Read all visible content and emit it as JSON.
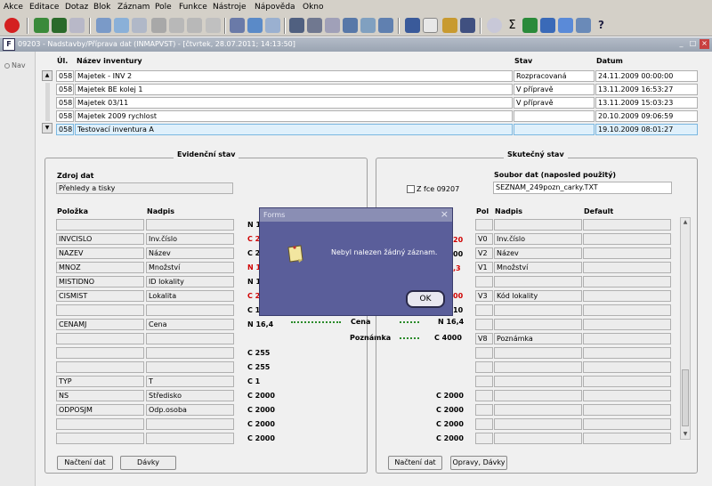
{
  "menu": [
    "Akce",
    "Editace",
    "Dotaz",
    "Blok",
    "Záznam",
    "Pole",
    "Funkce",
    "Nástroje",
    "Nápověda",
    "Okno"
  ],
  "window": {
    "title": "09203 - Nadstavby/Příprava dat (INMAPVST) - [čtvrtek, 28.07.2011; 14:13:50]",
    "icon_text": "F",
    "minimize": "_",
    "restore": "□",
    "close": "×"
  },
  "nav": {
    "label": "Nav"
  },
  "inventory": {
    "headers": {
      "ul": "Úl.",
      "name": "Název inventury",
      "status": "Stav",
      "date": "Datum"
    },
    "rows": [
      {
        "ul": "058",
        "name": "Majetek - INV 2",
        "status": "Rozpracovaná",
        "date": "24.11.2009 00:00:00"
      },
      {
        "ul": "058",
        "name": "Majetek BE kolej 1",
        "status": "V přípravě",
        "date": "13.11.2009 16:53:27"
      },
      {
        "ul": "058",
        "name": "Majetek 03/11",
        "status": "V přípravě",
        "date": "13.11.2009 15:03:23"
      },
      {
        "ul": "058",
        "name": "Majetek 2009 rychlost",
        "status": "",
        "date": "20.10.2009 09:06:59"
      },
      {
        "ul": "058",
        "name": "Testovací inventura A",
        "status": "",
        "date": "19.10.2009 08:01:27"
      }
    ]
  },
  "evidence": {
    "title": "Evidenční stav",
    "source_label": "Zdroj dat",
    "source_value": "Přehledy a tisky",
    "col_item": "Položka",
    "col_caption": "Nadpis",
    "rows": [
      {
        "item": "",
        "caption": "",
        "type": "N 1"
      },
      {
        "item": "INVCISLO",
        "caption": "Inv.číslo",
        "type": "C 2"
      },
      {
        "item": "NAZEV",
        "caption": "Název",
        "type": "C 2"
      },
      {
        "item": "MNOZ",
        "caption": "Množství",
        "type": "N 1"
      },
      {
        "item": "MISTIDNO",
        "caption": "ID lokality",
        "type": "N 1"
      },
      {
        "item": "CISMIST",
        "caption": "Lokalita",
        "type": "C 2"
      },
      {
        "item": "",
        "caption": "",
        "type": "C 1"
      },
      {
        "item": "CENAMJ",
        "caption": "Cena",
        "type": "N 16,4"
      },
      {
        "item": "",
        "caption": "",
        "type": ""
      },
      {
        "item": "",
        "caption": "",
        "type": "C 255"
      },
      {
        "item": "",
        "caption": "",
        "type": "C 255"
      },
      {
        "item": "TYP",
        "caption": "T",
        "type": "C 1"
      },
      {
        "item": "NS",
        "caption": "Středisko",
        "type": "C 2000"
      },
      {
        "item": "ODPOSJM",
        "caption": "Odp.osoba",
        "type": "C 2000"
      },
      {
        "item": "",
        "caption": "",
        "type": "C 2000"
      },
      {
        "item": "",
        "caption": "",
        "type": "C 2000"
      }
    ],
    "btn_load": "Načtení dat",
    "btn_batches": "Dávky"
  },
  "middle": {
    "rows": [
      {
        "label": "Cena",
        "type": "N 16,4"
      },
      {
        "label": "Poznámka",
        "type": "C 4000"
      }
    ],
    "partial_types": [
      "20",
      "00",
      ",3",
      "00",
      "10"
    ],
    "lower_types": [
      "C 2000",
      "C 2000",
      "C 2000",
      "C 2000"
    ]
  },
  "actual": {
    "title": "Skutečný stav",
    "file_label": "Soubor dat (naposled použitý)",
    "file_value": "SEZNAM_249pozn_carky.TXT",
    "checkbox_label": "Z fce 09207",
    "col_pol": "Pol",
    "col_caption": "Nadpis",
    "col_default": "Default",
    "rows": [
      {
        "pol": "",
        "caption": "",
        "default": ""
      },
      {
        "pol": "V0",
        "caption": "Inv.číslo",
        "default": ""
      },
      {
        "pol": "V2",
        "caption": "Název",
        "default": ""
      },
      {
        "pol": "V1",
        "caption": "Množství",
        "default": ""
      },
      {
        "pol": "",
        "caption": "",
        "default": ""
      },
      {
        "pol": "V3",
        "caption": "Kód lokality",
        "default": ""
      },
      {
        "pol": "",
        "caption": "",
        "default": ""
      },
      {
        "pol": "",
        "caption": "",
        "default": ""
      },
      {
        "pol": "V8",
        "caption": "Poznámka",
        "default": ""
      },
      {
        "pol": "",
        "caption": "",
        "default": ""
      },
      {
        "pol": "",
        "caption": "",
        "default": ""
      },
      {
        "pol": "",
        "caption": "",
        "default": ""
      },
      {
        "pol": "",
        "caption": "",
        "default": ""
      },
      {
        "pol": "",
        "caption": "",
        "default": ""
      },
      {
        "pol": "",
        "caption": "",
        "default": ""
      },
      {
        "pol": "",
        "caption": "",
        "default": ""
      }
    ],
    "btn_load": "Načtení dat",
    "btn_fix": "Opravy, Dávky"
  },
  "dialog": {
    "title": "Forms",
    "message": "Nebyl nalezen žádný záznam.",
    "ok": "OK",
    "close": "×"
  },
  "toolbar_icons": [
    "exit-icon",
    "save-icon",
    "add-icon",
    "print-preview-icon",
    "find-icon",
    "enter-query-icon",
    "execute-query-icon",
    "filter-icon",
    "sort-asc-icon",
    "sort-desc-icon",
    "print-icon",
    "export-icon",
    "mail-icon",
    "cut-icon",
    "copy-icon",
    "paste-icon",
    "calculator-icon",
    "chart-icon",
    "sigma-icon",
    "excel-icon",
    "word-icon",
    "help-icon",
    "info-icon"
  ]
}
